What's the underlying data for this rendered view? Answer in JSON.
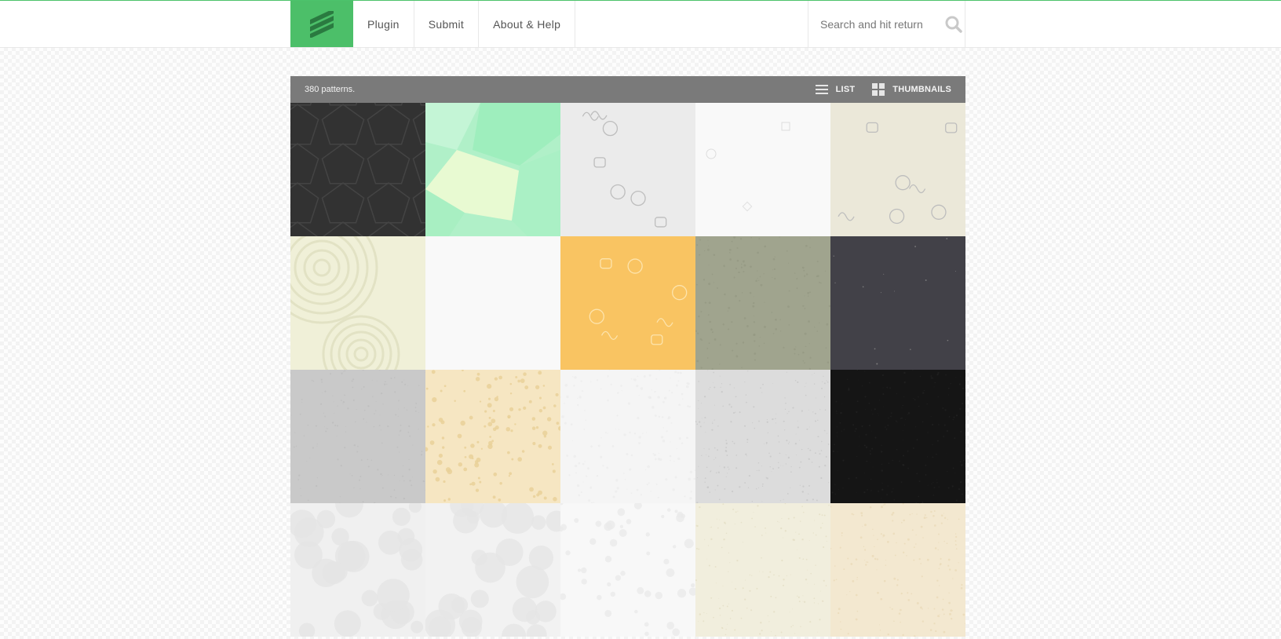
{
  "header": {
    "nav": [
      {
        "label": "Plugin"
      },
      {
        "label": "Submit"
      },
      {
        "label": "About & Help"
      }
    ],
    "search": {
      "placeholder": "Search and hit return",
      "icon": "search-icon"
    },
    "logo": {
      "icon": "stripes-logo-icon",
      "color": "#4cbf69"
    }
  },
  "toolbar": {
    "count_text": "380 patterns.",
    "list_label": "LIST",
    "thumbnails_label": "THUMBNAILS"
  },
  "patterns": [
    {
      "color": "#323232",
      "style": "hexagons"
    },
    {
      "color": "#b0f0c8",
      "style": "polygons"
    },
    {
      "color": "#ebebeb",
      "style": "doodles"
    },
    {
      "color": "#f9f9f9",
      "style": "sparse"
    },
    {
      "color": "#ebe8d9",
      "style": "doodles"
    },
    {
      "color": "#f0f0d8",
      "style": "swirls"
    },
    {
      "color": "#f9f9f9",
      "style": "plain"
    },
    {
      "color": "#f9c462",
      "style": "doodles-light"
    },
    {
      "color": "#a0a48e",
      "style": "noise"
    },
    {
      "color": "#424148",
      "style": "stars"
    },
    {
      "color": "#c9c9c9",
      "style": "linen"
    },
    {
      "color": "#f6e6c2",
      "style": "speckle"
    },
    {
      "color": "#f5f5f5",
      "style": "dots"
    },
    {
      "color": "#dcdcdc",
      "style": "grain"
    },
    {
      "color": "#151515",
      "style": "noise-dark"
    },
    {
      "color": "#f0f0f0",
      "style": "cloud"
    },
    {
      "color": "#f2f2f2",
      "style": "cloud"
    },
    {
      "color": "#f8f8f8",
      "style": "spots"
    },
    {
      "color": "#f1eedd",
      "style": "grain-light"
    },
    {
      "color": "#f3e8d0",
      "style": "mesh"
    }
  ]
}
